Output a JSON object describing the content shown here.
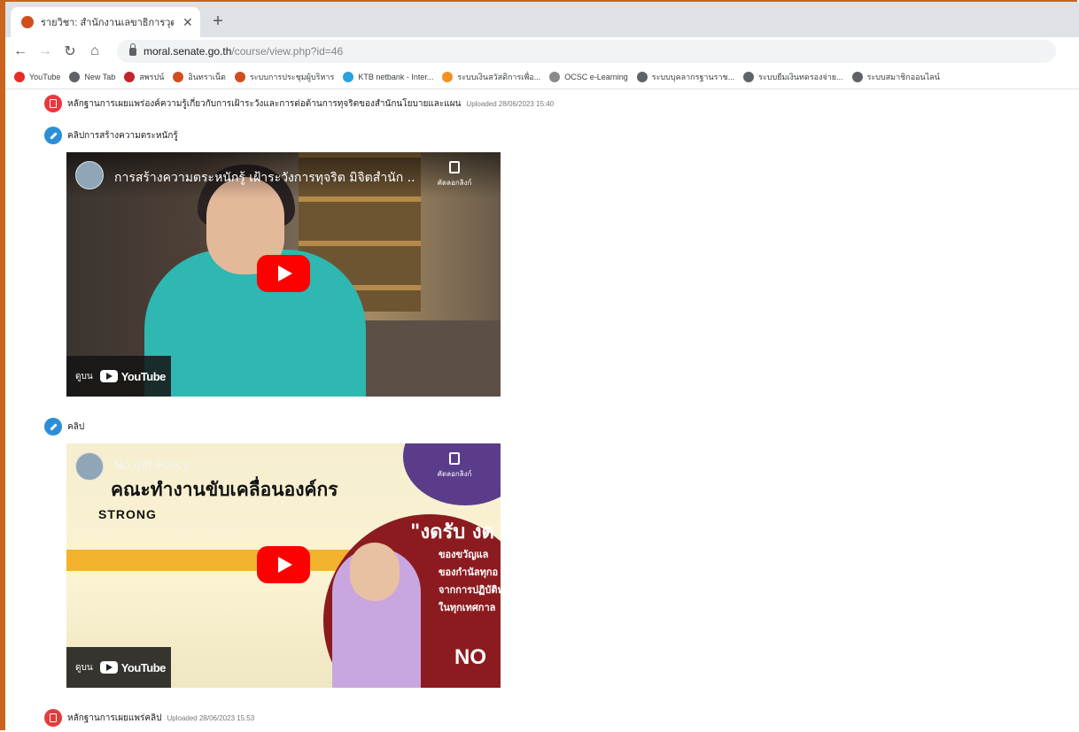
{
  "browser": {
    "tab": {
      "title": "รายวิชา: สำนักงานเลขาธิการวุฒิสภา"
    },
    "address": {
      "host": "moral.senate.go.th",
      "path": "/course/view.php?id=46"
    },
    "bookmarks": [
      {
        "label": "YouTube",
        "color": "#e52d27"
      },
      {
        "label": "New Tab",
        "color": "#5f6368"
      },
      {
        "label": "สพรปน์",
        "color": "#c0272d"
      },
      {
        "label": "อินทราเน็ต",
        "color": "#d24d1e"
      },
      {
        "label": "ระบบการประชุมผู้บริหาร",
        "color": "#d24d1e"
      },
      {
        "label": "KTB netbank - Inter...",
        "color": "#2aa1dc"
      },
      {
        "label": "ระบบเงินสวัสดิการเพื่อ...",
        "color": "#f29222"
      },
      {
        "label": "OCSC e-Learning",
        "color": "#8a8a8a"
      },
      {
        "label": "ระบบบุคลากรฐานราช...",
        "color": "#5f6368"
      },
      {
        "label": "ระบบยืมเงินทดรองจ่าย...",
        "color": "#5f6368"
      },
      {
        "label": "ระบบสมาชิกออนไลน์",
        "color": "#5f6368"
      }
    ]
  },
  "content": {
    "item1": {
      "label": "หลักฐานการเผยแพร่องค์ความรู้เกี่ยวกับการเฝ้าระวังและการต่อต้านการทุจริตของสำนักนโยบายและแผน",
      "meta": "Uploaded 28/06/2023 15:40"
    },
    "item2": {
      "label": "คลิปการสร้างความตระหนักรู้"
    },
    "video1": {
      "title": "การสร้างความตระหนักรู้ เฝ้าระวังการทุจริต มิจิตสำนัก ...",
      "copy_label": "คัดลอกลิงก์",
      "watch_label": "ดูบน",
      "yt_label": "YouTube"
    },
    "item3": {
      "label": "คลิป"
    },
    "video2": {
      "title": "No gift Policy",
      "copy_label": "คัดลอกลิงก์",
      "heading": "คณะทำงานขับเคลื่อนองค์กร",
      "strong": "STRONG",
      "quote": "\"งดรับ งด",
      "lines": [
        "ของขวัญแล",
        "ของกำนัลทุกอ",
        "จากการปฏิบัติห",
        "ในทุกเทศกาล"
      ],
      "no_text": "NO",
      "watch_label": "ดูบน",
      "yt_label": "YouTube"
    },
    "item4": {
      "label": "หลักฐานการเผยแพร่คลิป",
      "meta": "Uploaded 28/06/2023 15:53"
    }
  }
}
